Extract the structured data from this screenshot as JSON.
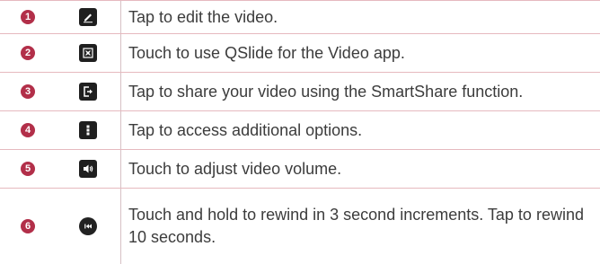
{
  "rows": [
    {
      "number": "1",
      "icon": "pencil-edit-icon",
      "text": "Tap to edit the video."
    },
    {
      "number": "2",
      "icon": "qslide-icon",
      "text": "Touch to use QSlide for the Video app."
    },
    {
      "number": "3",
      "icon": "share-icon",
      "text": "Tap to share your video using the SmartShare function."
    },
    {
      "number": "4",
      "icon": "more-options-icon",
      "text": "Tap to access additional options."
    },
    {
      "number": "5",
      "icon": "volume-icon",
      "text": "Touch to adjust video volume."
    },
    {
      "number": "6",
      "icon": "rewind-icon",
      "text": "Touch and hold to rewind in 3 second increments. Tap to rewind 10 seconds."
    }
  ],
  "colors": {
    "accent": "#b22f49",
    "border": "#e6b9bf",
    "icon": "#1f1f1f",
    "text": "#3c3c3c"
  }
}
